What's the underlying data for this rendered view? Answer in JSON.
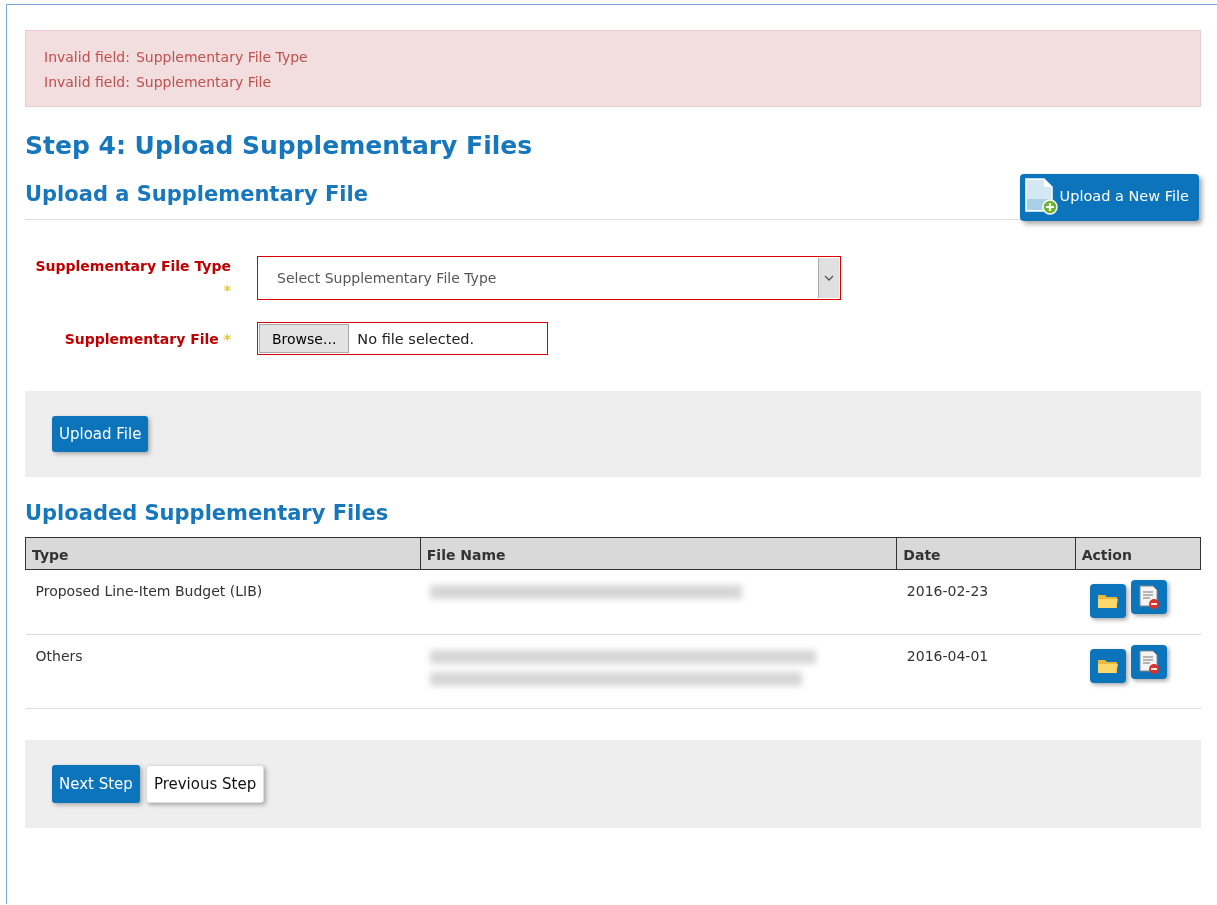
{
  "errors": [
    {
      "label": "Invalid field:",
      "field": "Supplementary File Type"
    },
    {
      "label": "Invalid field:",
      "field": "Supplementary File"
    }
  ],
  "title": "Step 4: Upload Supplementary Files",
  "upload_section": {
    "heading": "Upload a Supplementary File",
    "new_file_button": "Upload a New File",
    "fields": [
      {
        "kind": "select",
        "label": "Supplementary File Type",
        "required": "*",
        "invalid": true,
        "placeholder": "Select Supplementary File Type"
      },
      {
        "kind": "file",
        "label": "Supplementary File",
        "required": "*",
        "invalid": true,
        "button": "Browse...",
        "value": "No file selected."
      }
    ],
    "upload_button": "Upload File"
  },
  "uploaded_section": {
    "heading": "Uploaded Supplementary Files",
    "columns": [
      "Type",
      "File Name",
      "Date",
      "Action"
    ],
    "rows": [
      {
        "type": "Proposed Line-Item Budget (LIB)",
        "file_name": {
          "kind": "blurred-short"
        },
        "date": "2016-02-23"
      },
      {
        "type": "Others",
        "file_name": {
          "kind": "blurred-long"
        },
        "date": "2016-04-01"
      }
    ]
  },
  "nav_buttons": [
    {
      "label": "Next Step",
      "primary": true
    },
    {
      "label": "Previous Step",
      "primary": false
    }
  ]
}
